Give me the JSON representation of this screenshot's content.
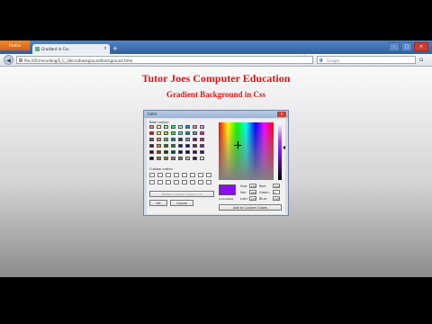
{
  "browser": {
    "menu_button": "Firefox",
    "tab_title": "Gradient in Css",
    "tab_close": "×",
    "new_tab": "+",
    "window_controls": {
      "minimize": "–",
      "maximize": "□",
      "close": "×"
    },
    "url": "file:///D:/recording/S_C_18/css/background/background.html",
    "search_placeholder": "Google",
    "search_engine": "g"
  },
  "page": {
    "heading": "Tutor Joes Computer Education",
    "subheading": "Gradient Background in Css"
  },
  "dialog": {
    "title": "Color",
    "close": "×",
    "basic_colors_label": "Basic colors:",
    "custom_colors_label": "Custom colors:",
    "define_custom_button": "Define Custom Colors >>",
    "ok_button": "OK",
    "cancel_button": "Cancel",
    "color_solid_label": "Color|Solid",
    "add_custom_button": "Add to Custom Colors",
    "fields": {
      "hue_label": "Hue:",
      "hue": "190",
      "sat_label": "Sat:",
      "sat": "240",
      "lum_label": "Lum:",
      "lum": "115",
      "red_label": "Red:",
      "red": "122",
      "green_label": "Green:",
      "green": "0",
      "blue_label": "Blue:",
      "blue": "245"
    },
    "selected_color": "#8b10f0",
    "basic_colors": [
      "#ff8080",
      "#ffff80",
      "#80ff80",
      "#00ff80",
      "#80ffff",
      "#0080ff",
      "#ff80c0",
      "#ff80ff",
      "#ff0000",
      "#ffff00",
      "#80ff00",
      "#00ff40",
      "#00ffff",
      "#0080c0",
      "#8080c0",
      "#ff00ff",
      "#804040",
      "#ff8040",
      "#00ff00",
      "#008080",
      "#004080",
      "#8080ff",
      "#800040",
      "#ff0080",
      "#800000",
      "#ff8000",
      "#008000",
      "#008040",
      "#0000ff",
      "#0000a0",
      "#800080",
      "#8000ff",
      "#400000",
      "#804000",
      "#004000",
      "#004040",
      "#000080",
      "#000040",
      "#400040",
      "#400080",
      "#000000",
      "#808000",
      "#808040",
      "#808080",
      "#408080",
      "#c0c0c0",
      "#400040",
      "#ffffff"
    ]
  }
}
